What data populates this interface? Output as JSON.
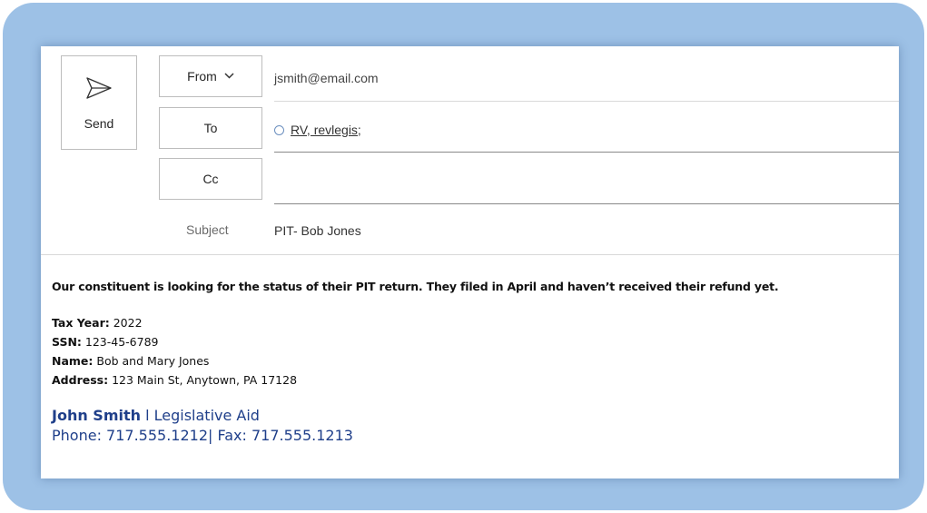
{
  "compose": {
    "send_label": "Send",
    "from_label": "From",
    "from_value": "jsmith@email.com",
    "to_label": "To",
    "to_recipient": "RV, revlegis;",
    "cc_label": "Cc",
    "subject_label": "Subject",
    "subject_value": "PIT- Bob Jones"
  },
  "body": {
    "intro": "Our constituent is looking for the status of their PIT return.  They filed in April and haven’t received their refund yet.",
    "fields": [
      {
        "label": "Tax Year:",
        "value": " 2022"
      },
      {
        "label": "SSN:",
        "value": " 123-45-6789"
      },
      {
        "label": "Name:",
        "value": " Bob and Mary Jones"
      },
      {
        "label": "Address:",
        "value": " 123 Main St, Anytown, PA 17128"
      }
    ]
  },
  "signature": {
    "name": "John Smith",
    "title": " l Legislative Aid",
    "contact": "Phone: 717.555.1212| Fax: 717.555.1213"
  },
  "colors": {
    "frame": "#9dc1e6",
    "signature": "#1f3f8a"
  },
  "icons": {
    "send": "send-paper-plane-icon",
    "from_dropdown": "chevron-down-icon",
    "recipient_status": "circle-icon"
  }
}
